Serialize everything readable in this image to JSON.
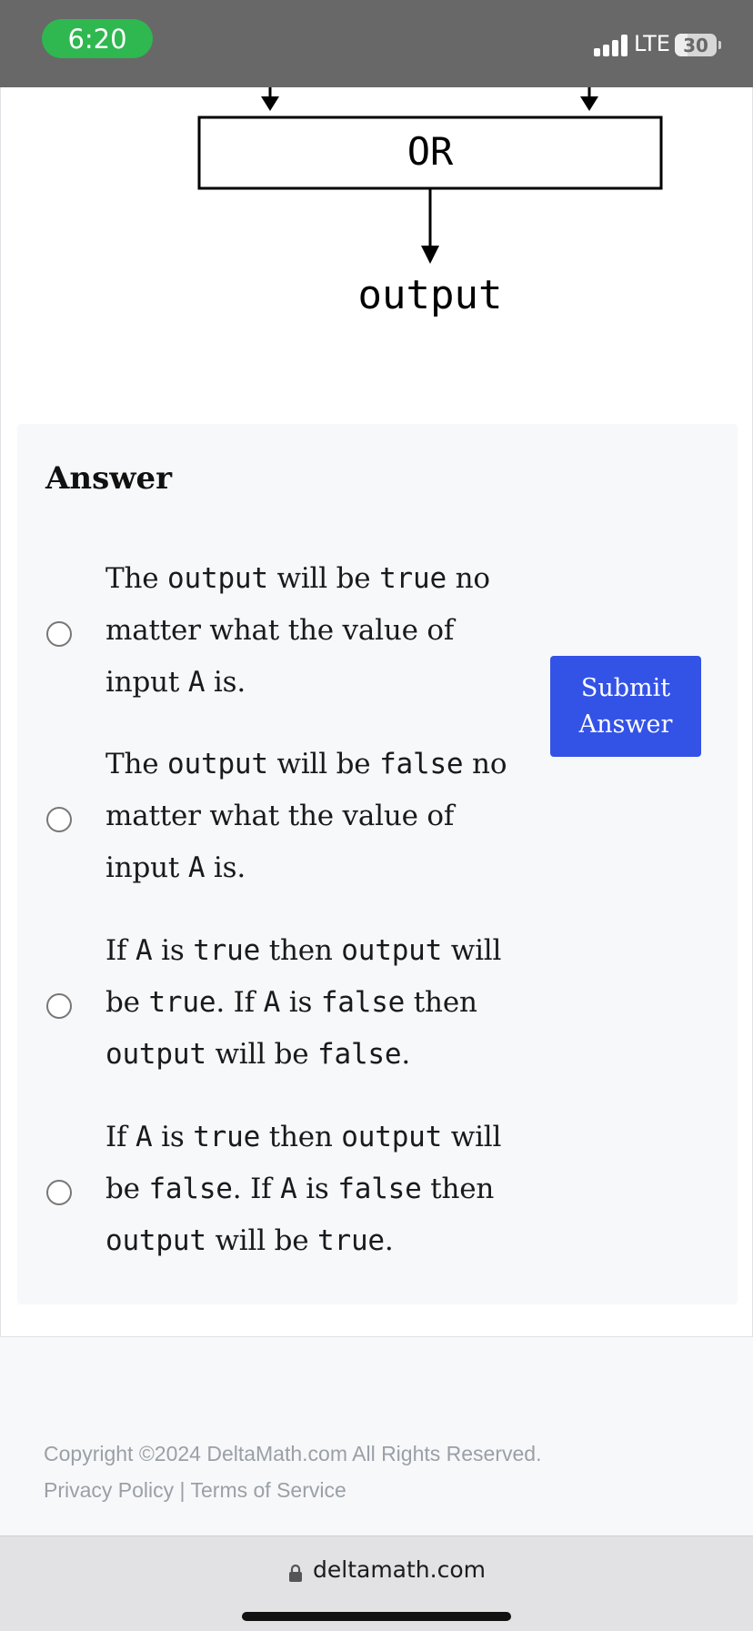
{
  "status_bar": {
    "time": "6:20",
    "network": "LTE",
    "battery_level": "30",
    "battery_fraction": 0.3
  },
  "diagram": {
    "gate_label": "OR",
    "output_label": "output"
  },
  "answer": {
    "title": "Answer",
    "submit_line1": "Submit",
    "submit_line2": "Answer",
    "options": [
      {
        "parts": [
          {
            "t": "The "
          },
          {
            "t": "output",
            "code": true
          },
          {
            "t": " will be "
          },
          {
            "t": "true",
            "code": true
          },
          {
            "t": " no matter what the value of input "
          },
          {
            "t": "A",
            "code": true
          },
          {
            "t": " is."
          }
        ]
      },
      {
        "parts": [
          {
            "t": "The "
          },
          {
            "t": "output",
            "code": true
          },
          {
            "t": " will be "
          },
          {
            "t": "false",
            "code": true
          },
          {
            "t": " no matter what the value of input "
          },
          {
            "t": "A",
            "code": true
          },
          {
            "t": " is."
          }
        ]
      },
      {
        "parts": [
          {
            "t": "If "
          },
          {
            "t": "A",
            "code": true
          },
          {
            "t": " is "
          },
          {
            "t": "true",
            "code": true
          },
          {
            "t": " then "
          },
          {
            "t": "output",
            "code": true
          },
          {
            "t": " will be "
          },
          {
            "t": "true",
            "code": true
          },
          {
            "t": ". If "
          },
          {
            "t": "A",
            "code": true
          },
          {
            "t": " is "
          },
          {
            "t": "false",
            "code": true
          },
          {
            "t": " then "
          },
          {
            "t": "output",
            "code": true
          },
          {
            "t": " will be "
          },
          {
            "t": "false",
            "code": true
          },
          {
            "t": "."
          }
        ]
      },
      {
        "parts": [
          {
            "t": "If "
          },
          {
            "t": "A",
            "code": true
          },
          {
            "t": " is "
          },
          {
            "t": "true",
            "code": true
          },
          {
            "t": " then "
          },
          {
            "t": "output",
            "code": true
          },
          {
            "t": " will be "
          },
          {
            "t": "false",
            "code": true
          },
          {
            "t": ". If "
          },
          {
            "t": "A",
            "code": true
          },
          {
            "t": " is "
          },
          {
            "t": "false",
            "code": true
          },
          {
            "t": " then "
          },
          {
            "t": "output",
            "code": true
          },
          {
            "t": " will be "
          },
          {
            "t": "true",
            "code": true
          },
          {
            "t": "."
          }
        ]
      }
    ]
  },
  "footer": {
    "copyright": "Copyright ©2024 DeltaMath.com All Rights Reserved.",
    "privacy": "Privacy Policy",
    "separator": "|",
    "terms": "Terms of Service"
  },
  "browser": {
    "url": "deltamath.com"
  },
  "colors": {
    "submit": "#3352e6",
    "time_pill": "#2eb84f",
    "status_bar": "#686868"
  }
}
